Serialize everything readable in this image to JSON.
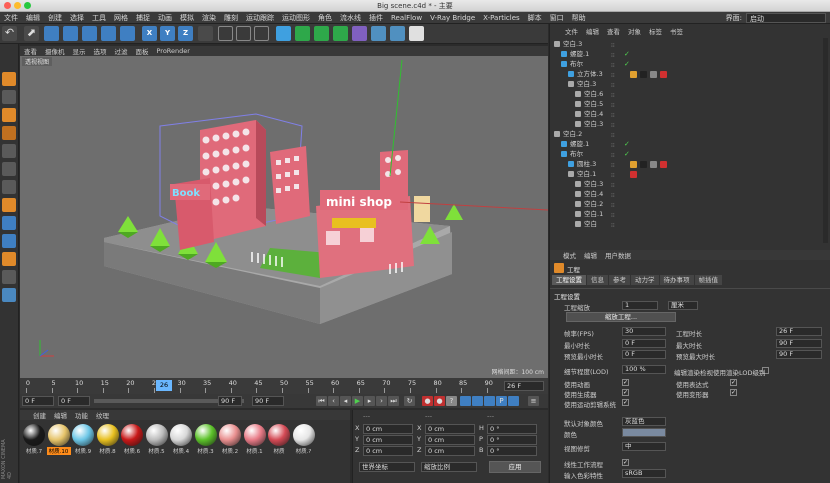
{
  "window": {
    "title": "Big scene.c4d * - 主要"
  },
  "menu": [
    "文件",
    "编辑",
    "创建",
    "选择",
    "工具",
    "网格",
    "捕捉",
    "动画",
    "模拟",
    "渲染",
    "雕刻",
    "运动跟踪",
    "运动图形",
    "角色",
    "流水线",
    "插件",
    "RealFlow",
    "V-Ray Bridge",
    "X-Particles",
    "脚本",
    "窗口",
    "帮助"
  ],
  "layout": {
    "label": "界面:",
    "value": "启动"
  },
  "viewport": {
    "menu": [
      "查看",
      "摄像机",
      "显示",
      "选项",
      "过滤",
      "面板",
      "ProRender"
    ],
    "label": "透视视图",
    "grid": "网格间距：100 cm",
    "sign": "mini shop",
    "book_sign": "Book"
  },
  "timeline": {
    "ticks": [
      "0",
      "5",
      "10",
      "15",
      "20",
      "25",
      "30",
      "35",
      "40",
      "45",
      "50",
      "55",
      "60",
      "65",
      "70",
      "75",
      "80",
      "85",
      "90"
    ],
    "current": "26",
    "frame_field": "26 F"
  },
  "transport": {
    "start": "0 F",
    "start2": "0 F",
    "end": "90 F",
    "end2": "90 F"
  },
  "materials": {
    "menu": [
      "创建",
      "编辑",
      "功能",
      "纹理"
    ],
    "items": [
      {
        "label": "材质.7",
        "color": "#1a1a1a"
      },
      {
        "label": "材质.10",
        "color": "#e6c46a"
      },
      {
        "label": "材质.9",
        "color": "#6cc6e6"
      },
      {
        "label": "材质.8",
        "color": "#e8c020"
      },
      {
        "label": "材质.6",
        "color": "#c81818"
      },
      {
        "label": "材质.5",
        "color": "#bcbcbc"
      },
      {
        "label": "材质.4",
        "color": "#d8d8d8"
      },
      {
        "label": "材质.3",
        "color": "#5cc22a"
      },
      {
        "label": "材质.2",
        "color": "#e98f8f"
      },
      {
        "label": "材质.1",
        "color": "#e87a86"
      },
      {
        "label": "材质",
        "color": "#d44a55"
      },
      {
        "label": "材质.?",
        "color": "#e6e6e6"
      }
    ],
    "side_brand": "MAXON CINEMA 4D"
  },
  "coords": {
    "header": [
      "---",
      "---",
      "---"
    ],
    "rows": [
      {
        "a": "X",
        "av": "0 cm",
        "b": "X",
        "bv": "0 cm",
        "c": "H",
        "cv": "0 °"
      },
      {
        "a": "Y",
        "av": "0 cm",
        "b": "Y",
        "bv": "0 cm",
        "c": "P",
        "cv": "0 °"
      },
      {
        "a": "Z",
        "av": "0 cm",
        "b": "Z",
        "bv": "0 cm",
        "c": "B",
        "cv": "0 °"
      }
    ],
    "dropdown1": "世界坐标",
    "dropdown2": "缩放比例",
    "apply": "应用"
  },
  "objects": {
    "menu": [
      "文件",
      "编辑",
      "查看",
      "对象",
      "标签",
      "书签"
    ],
    "rows": [
      {
        "name": "空白.3",
        "indent": 0,
        "icon": "null"
      },
      {
        "name": "螺旋.1",
        "indent": 1,
        "icon": "spline",
        "check": true
      },
      {
        "name": "布尔",
        "indent": 1,
        "icon": "boole",
        "check": true
      },
      {
        "name": "立方体.3",
        "indent": 2,
        "icon": "cube",
        "tags": [
          "#e0a030",
          "#222",
          "#888",
          "#d03030"
        ]
      },
      {
        "name": "空白.3",
        "indent": 2,
        "icon": "null"
      },
      {
        "name": "空白.6",
        "indent": 3,
        "icon": "null"
      },
      {
        "name": "空白.5",
        "indent": 3,
        "icon": "null"
      },
      {
        "name": "空白.4",
        "indent": 3,
        "icon": "null"
      },
      {
        "name": "空白.3",
        "indent": 3,
        "icon": "null"
      },
      {
        "name": "空白.2",
        "indent": 0,
        "icon": "null"
      },
      {
        "name": "螺旋.1",
        "indent": 1,
        "icon": "spline",
        "check": true
      },
      {
        "name": "布尔",
        "indent": 1,
        "icon": "boole",
        "check": true
      },
      {
        "name": "圆柱.3",
        "indent": 2,
        "icon": "cyl",
        "tags": [
          "#e0a030",
          "#222",
          "#888",
          "#d03030"
        ]
      },
      {
        "name": "空白.1",
        "indent": 2,
        "icon": "null",
        "tags": [
          "#d03030"
        ]
      },
      {
        "name": "空白.3",
        "indent": 3,
        "icon": "null"
      },
      {
        "name": "空白.4",
        "indent": 3,
        "icon": "null"
      },
      {
        "name": "空白.2",
        "indent": 3,
        "icon": "null"
      },
      {
        "name": "空白.1",
        "indent": 3,
        "icon": "null"
      },
      {
        "name": "空白",
        "indent": 3,
        "icon": "null"
      }
    ]
  },
  "attributes": {
    "menu": [
      "模式",
      "编辑",
      "用户数据"
    ],
    "title": "工程",
    "tabs": [
      "工程设置",
      "信息",
      "参考",
      "动力学",
      "待办事项",
      "帧插值"
    ],
    "section": "工程设置",
    "scale_label": "工程缩放",
    "scale_value": "1",
    "scale_unit": "厘米",
    "scale_btn": "缩放工程...",
    "left": [
      {
        "label": "帧率(FPS)",
        "value": "30"
      },
      {
        "label": "最小时长",
        "value": "0 F"
      },
      {
        "label": "预览最小时长",
        "value": "0 F"
      },
      {
        "label": "细节程度(LOD)",
        "value": "100 %"
      }
    ],
    "right": [
      {
        "label": "工程时长",
        "value": "26 F"
      },
      {
        "label": "最大时长",
        "value": "90 F"
      },
      {
        "label": "预览最大时长",
        "value": "90 F"
      }
    ],
    "lod_check": "编辑渲染检视使用渲染LOD级别",
    "checks_left": [
      "使用动画",
      "使用生成器",
      "使用运动剪辑系统"
    ],
    "checks_right": [
      "使用表达式",
      "使用变形器"
    ],
    "default_color_label": "默认对象颜色",
    "default_color_value": "灰蓝色",
    "color_label": "颜色",
    "view_clip_label": "视图修剪",
    "view_clip_value": "中",
    "linear_label": "线性工作流程",
    "input_color_label": "输入色彩特性",
    "input_color_value": "sRGB"
  },
  "colors": {
    "accent": "#ff8c1a",
    "viewport_bg": "#6e6e6e",
    "building": "#e06a7a"
  }
}
